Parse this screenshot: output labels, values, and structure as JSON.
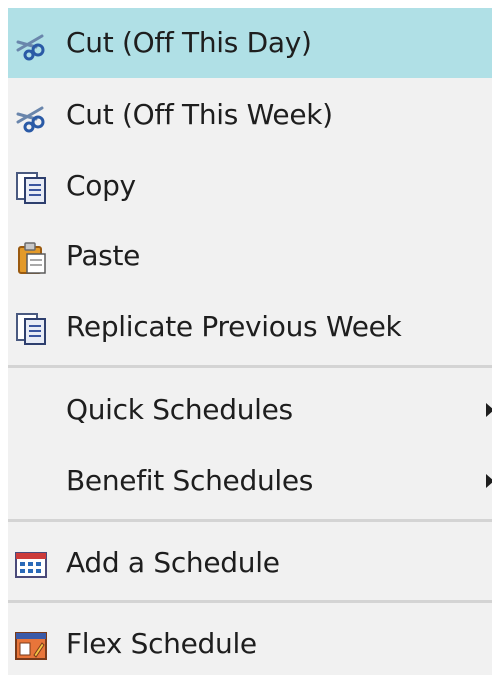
{
  "menu": {
    "highlight_color": "#b0e0e6",
    "items": [
      {
        "label": "Cut (Off This Day)",
        "icon": "scissors-icon",
        "highlighted": true
      },
      {
        "label": "Cut (Off This Week)",
        "icon": "scissors-icon"
      },
      {
        "label": "Copy",
        "icon": "copy-icon"
      },
      {
        "label": "Paste",
        "icon": "paste-icon"
      },
      {
        "label": "Replicate Previous Week",
        "icon": "replicate-icon"
      },
      {
        "label": "Quick Schedules",
        "icon": "",
        "has_submenu": true
      },
      {
        "label": "Benefit Schedules",
        "icon": "",
        "has_submenu": true
      },
      {
        "label": "Add a Schedule",
        "icon": "calendar-icon"
      },
      {
        "label": "Flex Schedule",
        "icon": "flex-schedule-icon"
      }
    ]
  }
}
